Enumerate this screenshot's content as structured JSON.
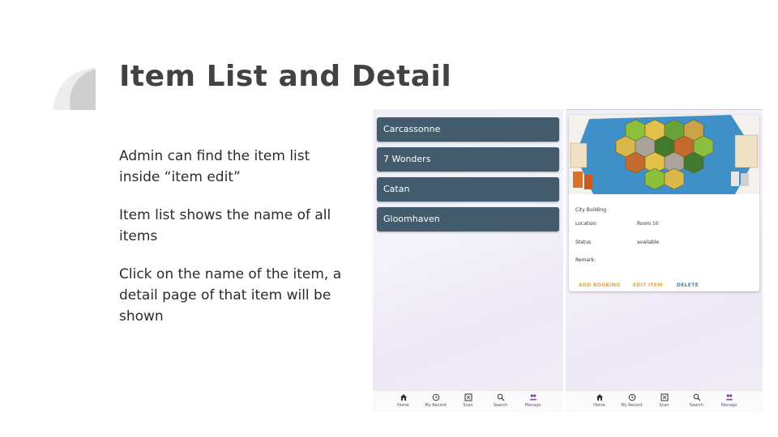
{
  "slide": {
    "title": "Item List and Detail",
    "bullets": [
      "Admin can find the item list inside “item edit”",
      "Item list shows the name of all items",
      "Click on the name of the item, a detail page of that item will be shown"
    ]
  },
  "item_list": {
    "items": [
      "Carcassonne",
      "7 Wonders",
      "Catan",
      "Gloomhaven"
    ]
  },
  "item_detail": {
    "name": "City Building",
    "location_label": "Location:",
    "location_value": "Room 10",
    "status_label": "Status",
    "status_value": "available",
    "remark_label": "Remark:",
    "buttons": {
      "add_booking": "ADD BOOKING",
      "edit_item": "EDIT ITEM",
      "delete": "DELETE"
    }
  },
  "bottom_nav": {
    "items": [
      "Home",
      "My Record",
      "Scan",
      "Search",
      "Manage"
    ],
    "active": "Manage"
  },
  "colors": {
    "title": "#424242",
    "item_card": "#425c6e",
    "accent_orange": "#e8a33b",
    "accent_blue": "#3a86c8",
    "nav_active": "#7b3fa6"
  }
}
